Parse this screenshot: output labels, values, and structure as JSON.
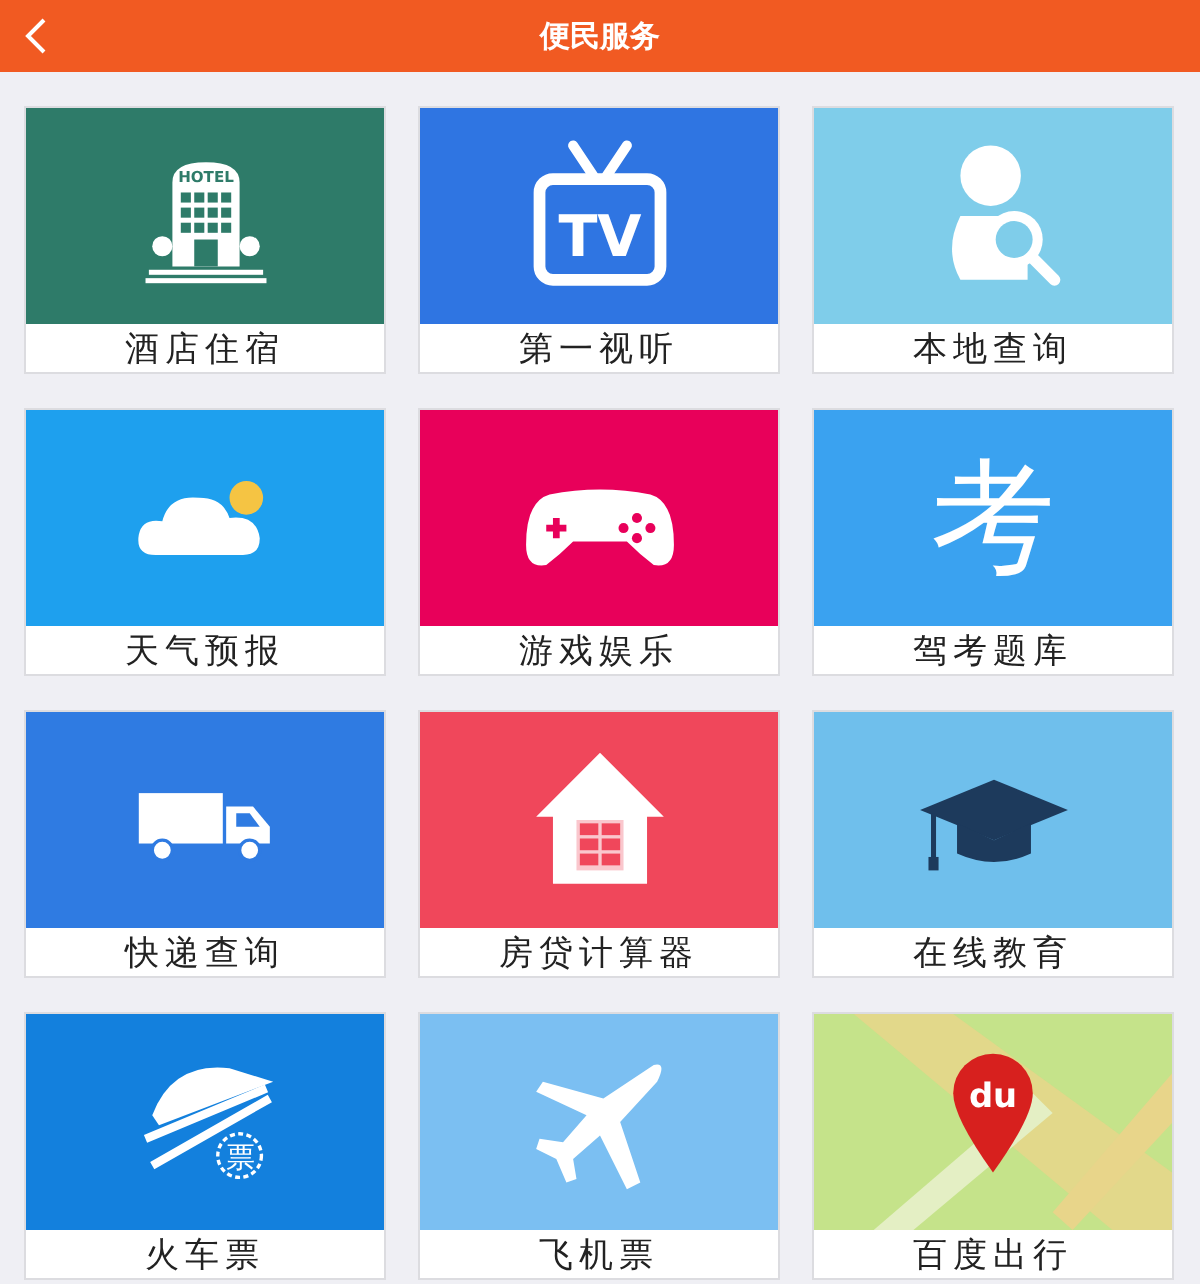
{
  "header": {
    "title": "便民服务"
  },
  "tiles": [
    {
      "label": "酒店住宿",
      "kind": "hotel",
      "color": "#2e7b69",
      "icon_text": "HOTEL"
    },
    {
      "label": "第一视听",
      "kind": "tv",
      "color": "#2f75e2",
      "icon_text": "TV"
    },
    {
      "label": "本地查询",
      "kind": "person-search",
      "color": "#7fcdea"
    },
    {
      "label": "天气预报",
      "kind": "weather",
      "color": "#1ea0ee"
    },
    {
      "label": "游戏娱乐",
      "kind": "gamepad",
      "color": "#e8005a"
    },
    {
      "label": "驾考题库",
      "kind": "glyph",
      "color": "#3aa2f0",
      "icon_text": "考"
    },
    {
      "label": "快递查询",
      "kind": "truck",
      "color": "#2f7be2"
    },
    {
      "label": "房贷计算器",
      "kind": "house",
      "color": "#f0475b"
    },
    {
      "label": "在线教育",
      "kind": "cap",
      "color": "#6fbfec"
    },
    {
      "label": "火车票",
      "kind": "train",
      "color": "#1380dd",
      "icon_text": "票"
    },
    {
      "label": "飞机票",
      "kind": "plane",
      "color": "#7bbff2"
    },
    {
      "label": "百度出行",
      "kind": "map",
      "color": "#c5e38a",
      "icon_text": "du"
    }
  ]
}
